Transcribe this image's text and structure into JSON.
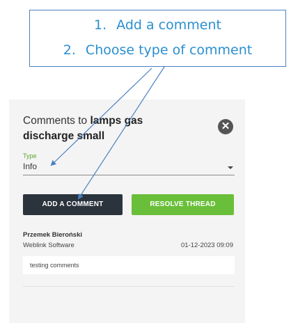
{
  "callout": {
    "step1_num": "1.",
    "step1_text": "Add a comment",
    "step2_num": "2.",
    "step2_text": "Choose type of comment"
  },
  "panel": {
    "title_prefix": "Comments to ",
    "title_bold_1": "lamps gas",
    "title_bold_2": "discharge small",
    "close_symbol": "✕",
    "type_label": "Type",
    "type_value": "Info",
    "add_button": "ADD A COMMENT",
    "resolve_button": "RESOLVE THREAD",
    "comment": {
      "author": "Przemek Bieroński",
      "company": "Weblink Software",
      "date": "01-12-2023 09:09",
      "text": "testing comments"
    }
  },
  "colors": {
    "callout_text": "#2a8fd0",
    "callout_border": "#4a80c2",
    "arrow": "#4a80c2",
    "add_button_bg": "#2b333d",
    "resolve_button_bg": "#6abf3a",
    "type_label": "#5aa52d"
  },
  "icons": {
    "close": "close-icon",
    "dropdown": "chevron-down-icon"
  }
}
